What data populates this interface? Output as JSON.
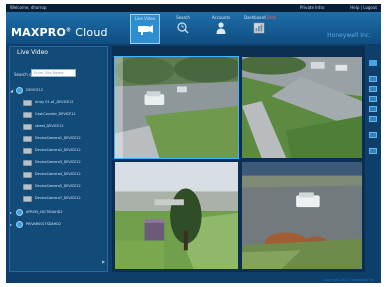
{
  "topbar": {
    "left_text": "Welcome, dharrop",
    "right_text_1": "Private Intro",
    "right_text_2": "Help | Logout"
  },
  "header": {
    "logo_brand": "MAXPRO",
    "logo_rest": "Cloud",
    "installer": "Honeywell Inc.",
    "nav": [
      {
        "label": "Live Video",
        "icon": "camera-icon"
      },
      {
        "label": "Search",
        "icon": "search-clock-icon"
      },
      {
        "label": "Accounts",
        "icon": "user-icon"
      },
      {
        "label": "Dashboard",
        "sub": "Beta",
        "icon": "dashboard-icon"
      }
    ]
  },
  "sidebar": {
    "title": "Live Video",
    "search_label": "Search site",
    "search_placeholder": "Enter Site Name",
    "tree": [
      {
        "text": "DEVICE12",
        "level": 0,
        "kind": "site"
      },
      {
        "text": "Array 01 a1_DEVICE12",
        "level": 1,
        "kind": "camera"
      },
      {
        "text": "CashCounter_DEVICE12",
        "level": 1,
        "kind": "camera"
      },
      {
        "text": "street_DEVICE12",
        "level": 1,
        "kind": "camera"
      },
      {
        "text": "DeviceCamera1_DEVICE12",
        "level": 1,
        "kind": "camera"
      },
      {
        "text": "DeviceCamera2_DEVICE12",
        "level": 1,
        "kind": "camera"
      },
      {
        "text": "DeviceCamera3_DEVICE12",
        "level": 1,
        "kind": "camera"
      },
      {
        "text": "DeviceCamera4_DEVICE12",
        "level": 1,
        "kind": "camera"
      },
      {
        "text": "DeviceCamera5_DEVICE12",
        "level": 1,
        "kind": "camera"
      },
      {
        "text": "DeviceCamera7_DEVICE12",
        "level": 1,
        "kind": "camera"
      },
      {
        "text": "APRON_001TSDAHD2",
        "level": 0,
        "kind": "site"
      },
      {
        "text": "PRIVAR001TSDAHD2",
        "level": 0,
        "kind": "site"
      }
    ]
  },
  "footer": {
    "text": "Copyright 2015 Honeywell Inc."
  },
  "colors": {
    "app_bg": "#0d3f6a",
    "header_top": "#1f6ea8",
    "accent": "#3db5ff",
    "selected_tile": "#3db5ff"
  }
}
